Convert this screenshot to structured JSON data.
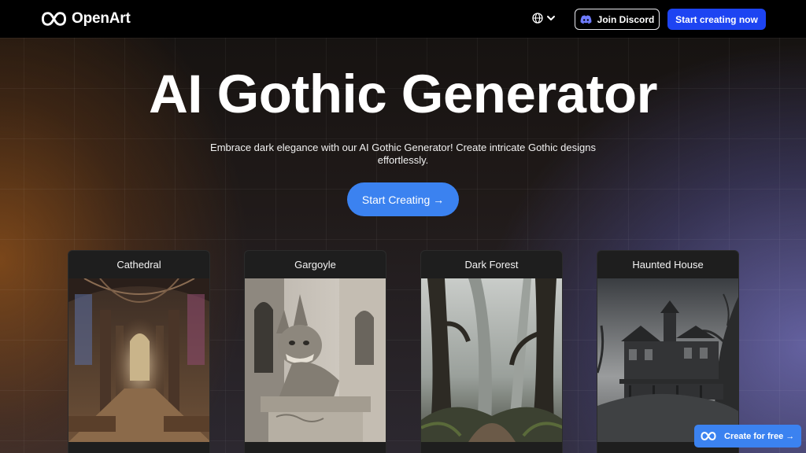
{
  "header": {
    "brand": "OpenArt",
    "discord_label": "Join Discord",
    "start_now_label": "Start creating now"
  },
  "hero": {
    "title": "AI Gothic Generator",
    "subtitle": "Embrace dark elegance with our AI Gothic Generator! Create intricate Gothic designs effortlessly.",
    "cta_label": "Start Creating →"
  },
  "cards": [
    {
      "title": "Cathedral"
    },
    {
      "title": "Gargoyle"
    },
    {
      "title": "Dark Forest"
    },
    {
      "title": "Haunted House"
    }
  ],
  "floating": {
    "label": "Create for free →"
  },
  "colors": {
    "primary_blue": "#1d44f2",
    "cta_blue": "#3b82f0",
    "header_bg": "#000000",
    "card_bg": "#1e1e1e"
  },
  "icons": {
    "logo": "infinity-logo-icon",
    "language": "globe-icon",
    "language_toggle": "chevron-down-icon",
    "discord": "discord-icon"
  }
}
